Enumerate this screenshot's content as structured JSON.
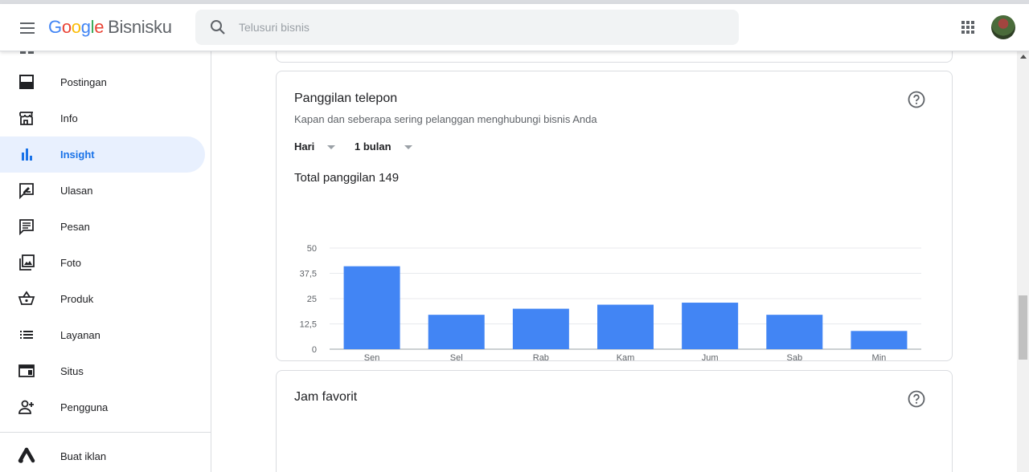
{
  "header": {
    "menu_icon": "menu-icon",
    "logo": {
      "g1": "G",
      "g2": "o",
      "g3": "o",
      "g4": "g",
      "g5": "l",
      "g6": "e",
      "product": "Bisnisku"
    },
    "search_placeholder": "Telusuri bisnis",
    "apps_icon": "apps-grid-icon",
    "avatar_icon": "account-avatar"
  },
  "sidebar": {
    "items": [
      {
        "label": "Postingan",
        "icon": "posts-icon",
        "active": false
      },
      {
        "label": "Info",
        "icon": "storefront-icon",
        "active": false
      },
      {
        "label": "Insight",
        "icon": "bar-chart-icon",
        "active": true
      },
      {
        "label": "Ulasan",
        "icon": "review-icon",
        "active": false
      },
      {
        "label": "Pesan",
        "icon": "message-icon",
        "active": false
      },
      {
        "label": "Foto",
        "icon": "photo-library-icon",
        "active": false
      },
      {
        "label": "Produk",
        "icon": "basket-icon",
        "active": false
      },
      {
        "label": "Layanan",
        "icon": "list-icon",
        "active": false
      },
      {
        "label": "Situs",
        "icon": "website-icon",
        "active": false
      },
      {
        "label": "Pengguna",
        "icon": "add-user-icon",
        "active": false
      },
      {
        "label": "Buat iklan",
        "icon": "google-ads-icon",
        "active": false
      }
    ]
  },
  "calls_card": {
    "title": "Panggilan telepon",
    "subtitle": "Kapan dan seberapa sering pelanggan menghubungi bisnis Anda",
    "dropdown_day": "Hari",
    "dropdown_period": "1 bulan",
    "total_text": "Total panggilan 149"
  },
  "favorite_card": {
    "title": "Jam favorit"
  },
  "colors": {
    "accent": "#1a73e8",
    "bar": "#4285f4",
    "active_bg": "#e8f0fe"
  },
  "chart_data": {
    "type": "bar",
    "title": "",
    "xlabel": "",
    "ylabel": "",
    "categories": [
      "Sen",
      "Sel",
      "Rab",
      "Kam",
      "Jum",
      "Sab",
      "Min"
    ],
    "values": [
      41,
      17,
      20,
      22,
      23,
      17,
      9
    ],
    "ylim": [
      0,
      50
    ],
    "yticks": [
      "0",
      "12,5",
      "25",
      "37,5",
      "50"
    ],
    "ytick_values": [
      0,
      12.5,
      25,
      37.5,
      50
    ],
    "grid": true,
    "legend": "none"
  }
}
